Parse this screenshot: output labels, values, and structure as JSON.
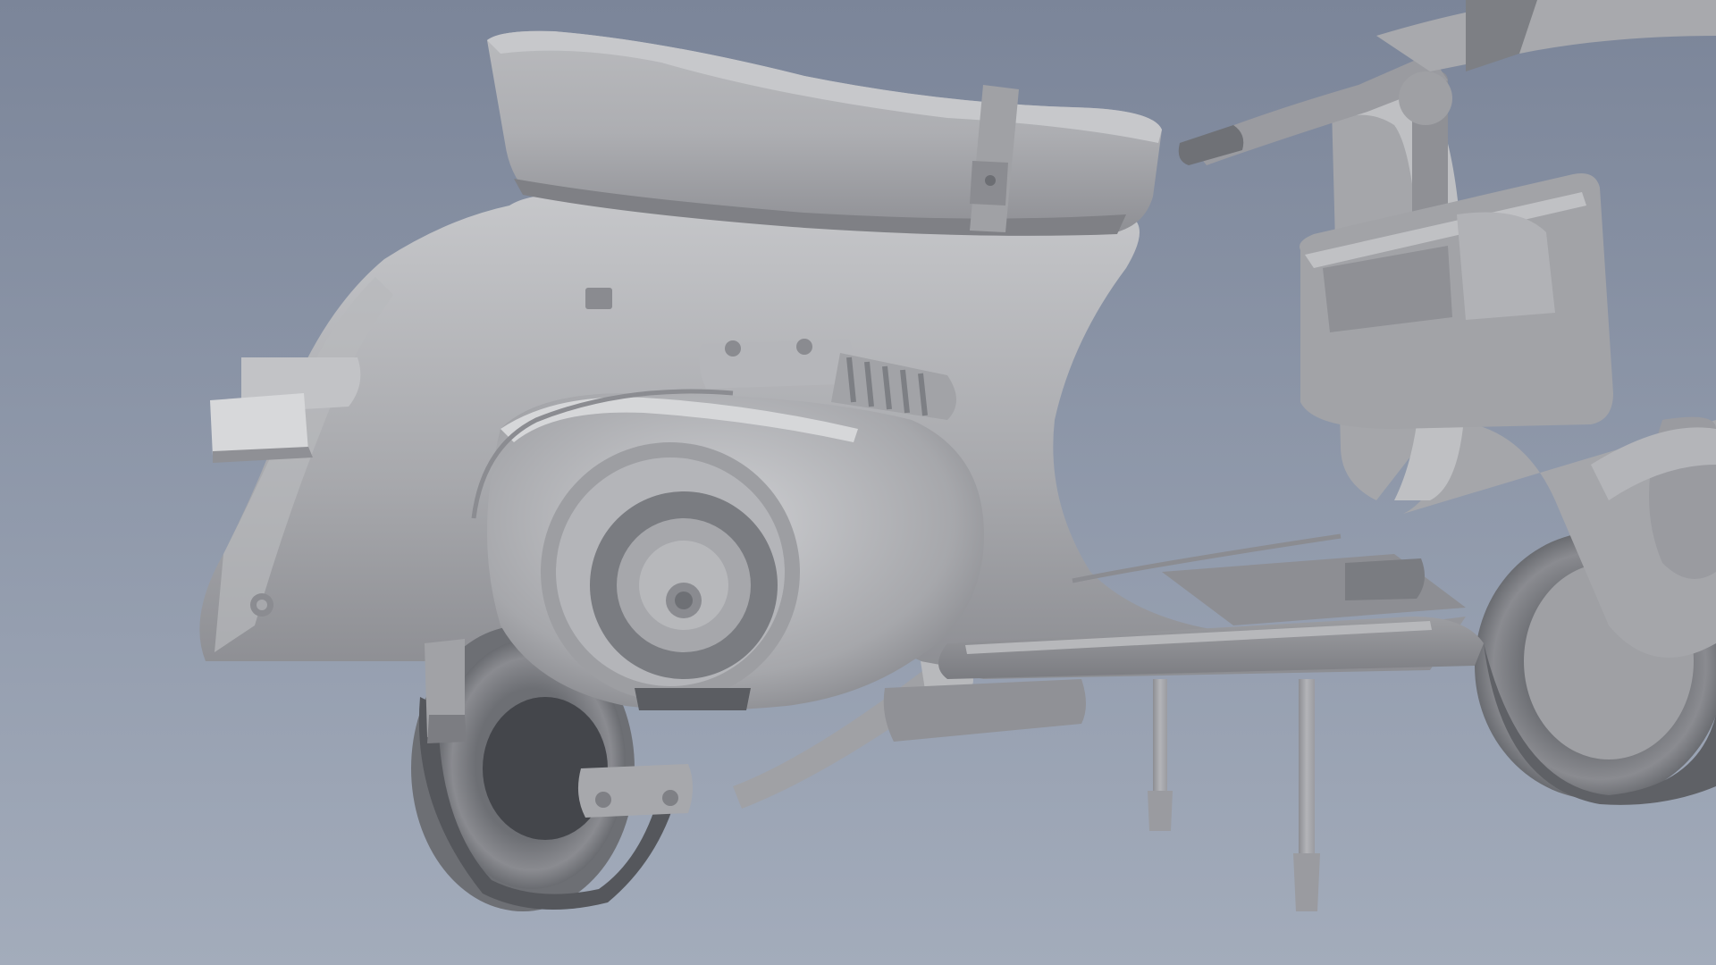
{
  "scene": {
    "subject": "vespa-scooter-clay-render",
    "background_top": "#7b8599",
    "background_bottom": "#a3acbb",
    "clay_light": "#c9cacd",
    "clay_mid": "#a9aaae",
    "clay_dark": "#6f7176",
    "clay_shadow": "#4f5156"
  }
}
